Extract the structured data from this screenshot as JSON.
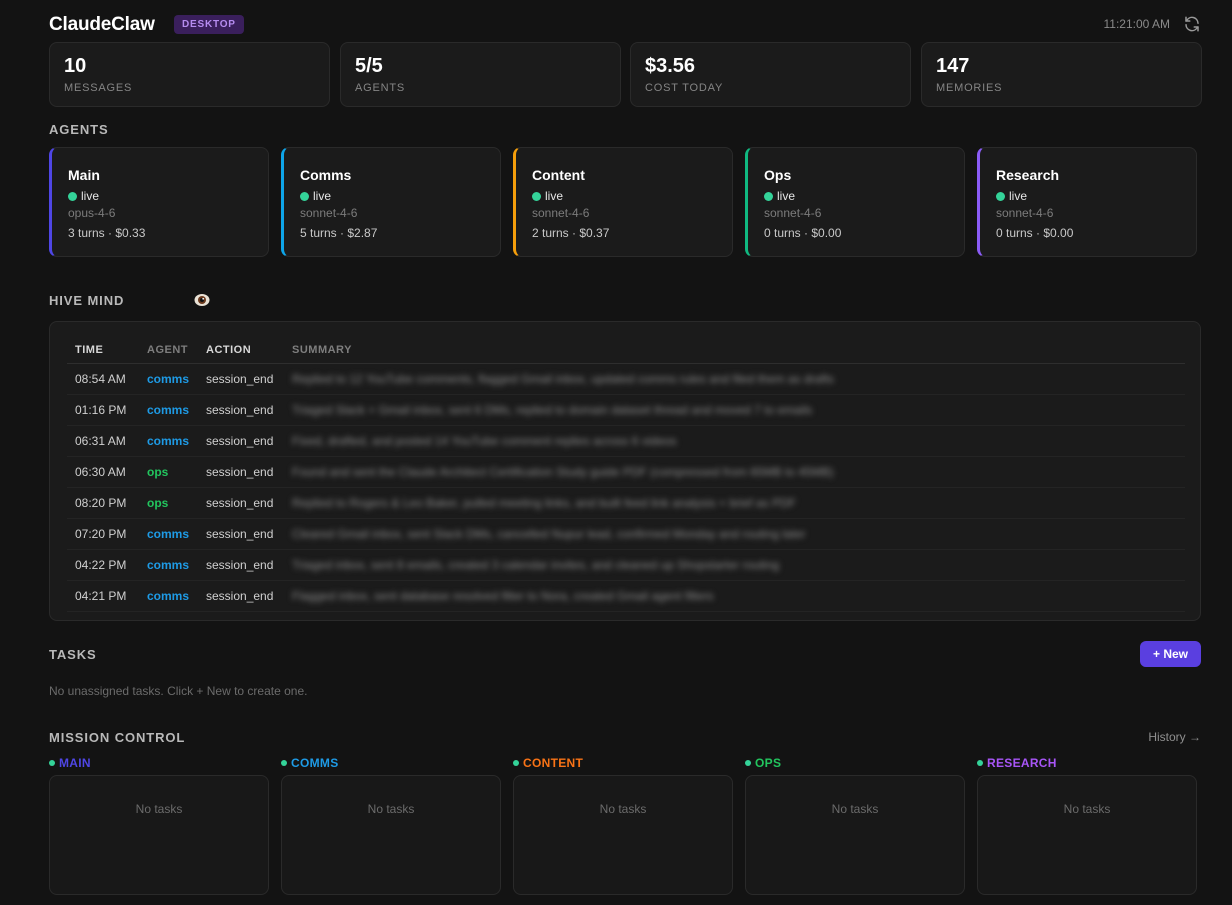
{
  "header": {
    "title": "ClaudeClaw",
    "badge": "DESKTOP",
    "time": "11:21:00 AM",
    "refresh_icon": "refresh-icon"
  },
  "stats": [
    {
      "value": "10",
      "label": "MESSAGES"
    },
    {
      "value": "5/5",
      "label": "AGENTS"
    },
    {
      "value": "$3.56",
      "label": "COST TODAY"
    },
    {
      "value": "147",
      "label": "MEMORIES"
    }
  ],
  "agents_section": {
    "title": "AGENTS"
  },
  "agents": [
    {
      "name": "Main",
      "status": "live",
      "model": "opus-4-6",
      "meta": "3 turns · $0.33",
      "color": "#4f46e5"
    },
    {
      "name": "Comms",
      "status": "live",
      "model": "sonnet-4-6",
      "meta": "5 turns · $2.87",
      "color": "#0ea5e9"
    },
    {
      "name": "Content",
      "status": "live",
      "model": "sonnet-4-6",
      "meta": "2 turns · $0.37",
      "color": "#f59e0b"
    },
    {
      "name": "Ops",
      "status": "live",
      "model": "sonnet-4-6",
      "meta": "0 turns · $0.00",
      "color": "#10b981"
    },
    {
      "name": "Research",
      "status": "live",
      "model": "sonnet-4-6",
      "meta": "0 turns · $0.00",
      "color": "#8b5cf6"
    }
  ],
  "hive": {
    "title": "HIVE MIND",
    "icon": "eye-icon",
    "headers": [
      "TIME",
      "AGENT",
      "ACTION",
      "SUMMARY"
    ],
    "rows": [
      {
        "time": "08:54 AM",
        "agent": "comms",
        "action": "session_end",
        "summary": "Replied to 12 YouTube comments, flagged Gmail inbox, updated comms rules and filed them as drafts"
      },
      {
        "time": "01:16 PM",
        "agent": "comms",
        "action": "session_end",
        "summary": "Triaged Slack + Gmail inbox, sent 6 DMs, replied to domain dataset thread and moved 7 to emails"
      },
      {
        "time": "06:31 AM",
        "agent": "comms",
        "action": "session_end",
        "summary": "Fixed, drafted, and posted 14 YouTube comment replies across 6 videos"
      },
      {
        "time": "06:30 AM",
        "agent": "ops",
        "action": "session_end",
        "summary": "Found and sent the Claude Architect Certification Study guide PDF (compressed from 65MB to 45MB)"
      },
      {
        "time": "08:20 PM",
        "agent": "ops",
        "action": "session_end",
        "summary": "Replied to Rogers & Leo Baker, pulled meeting links, and built feed link analysis + brief as PDF"
      },
      {
        "time": "07:20 PM",
        "agent": "comms",
        "action": "session_end",
        "summary": "Cleared Gmail inbox, sent Slack DMs, cancelled Nupur lead, confirmed Monday and routing later"
      },
      {
        "time": "04:22 PM",
        "agent": "comms",
        "action": "session_end",
        "summary": "Triaged inbox, sent 8 emails, created 3 calendar invites, and cleaned up Shopstarter routing"
      },
      {
        "time": "04:21 PM",
        "agent": "comms",
        "action": "session_end",
        "summary": "Flagged inbox, sent database resolved filter to Nora, created Gmail agent filters"
      }
    ],
    "agent_colors": {
      "comms": "#1e9be6",
      "ops": "#22c55e"
    }
  },
  "tasks": {
    "title": "TASKS",
    "new_label": "+ New",
    "empty": "No unassigned tasks. Click + New to create one."
  },
  "mission": {
    "title": "MISSION CONTROL",
    "history": "History →",
    "columns": [
      {
        "label": "MAIN",
        "color": "#4f46e5",
        "empty": "No tasks"
      },
      {
        "label": "COMMS",
        "color": "#1e9be6",
        "empty": "No tasks"
      },
      {
        "label": "CONTENT",
        "color": "#f97316",
        "empty": "No tasks"
      },
      {
        "label": "OPS",
        "color": "#22c55e",
        "empty": "No tasks"
      },
      {
        "label": "RESEARCH",
        "color": "#a855f7",
        "empty": "No tasks"
      }
    ]
  }
}
